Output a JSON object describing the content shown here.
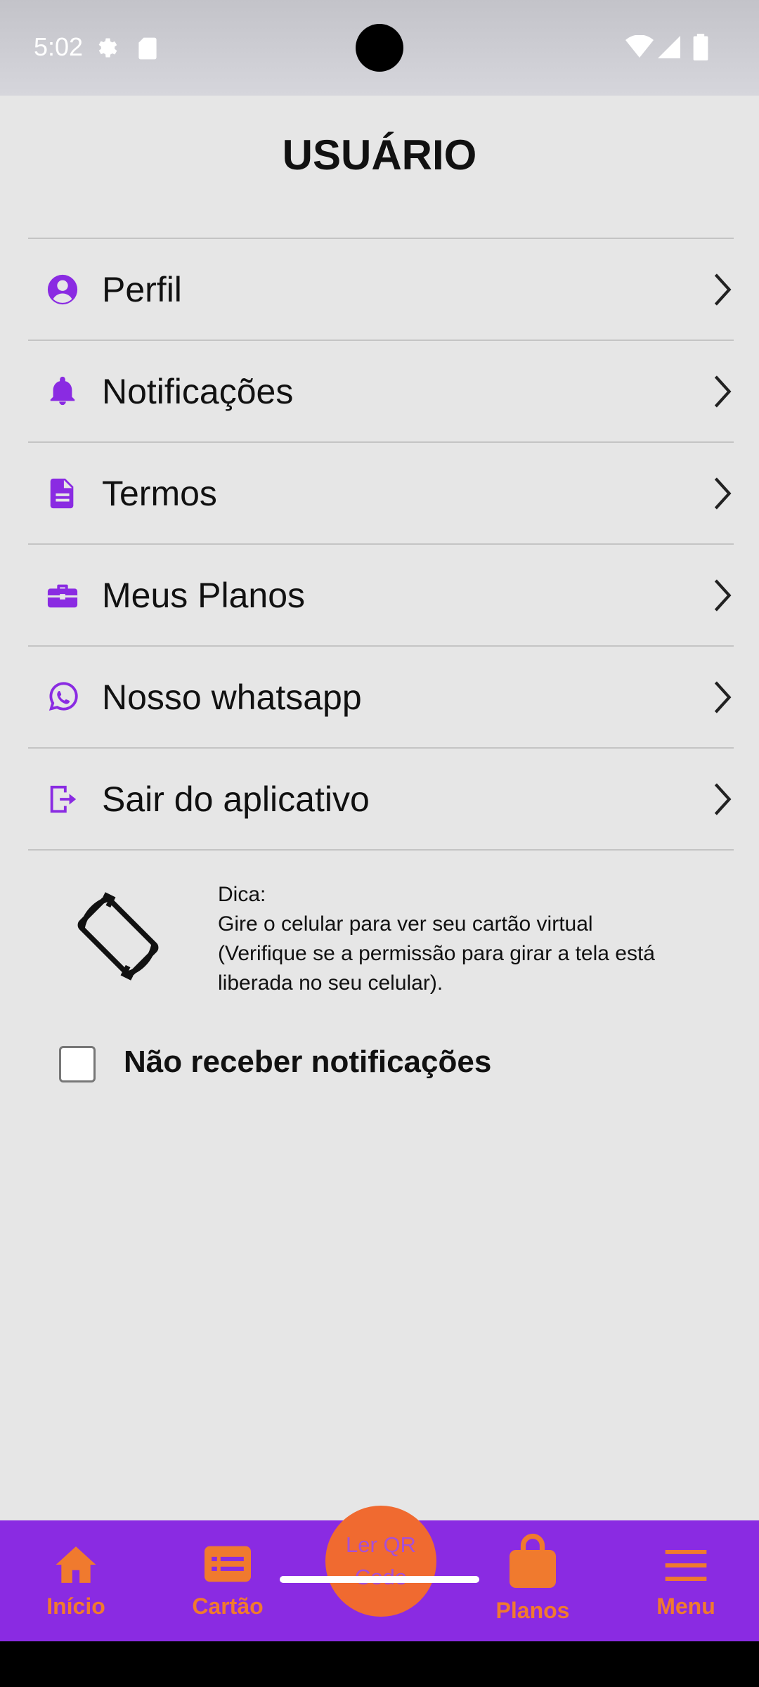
{
  "status_bar": {
    "time": "5:02",
    "icons": [
      "gear-icon",
      "sd-card-icon",
      "wifi-icon",
      "signal-icon",
      "battery-icon"
    ]
  },
  "header": {
    "title": "USUÁRIO"
  },
  "menu": {
    "accent_color": "#8a2be2",
    "items": [
      {
        "label": "Perfil",
        "icon": "account-circle-icon"
      },
      {
        "label": "Notificações",
        "icon": "bell-icon"
      },
      {
        "label": "Termos",
        "icon": "document-icon"
      },
      {
        "label": "Meus Planos",
        "icon": "briefcase-icon"
      },
      {
        "label": "Nosso whatsapp",
        "icon": "whatsapp-icon"
      },
      {
        "label": "Sair do aplicativo",
        "icon": "logout-icon"
      }
    ]
  },
  "tip": {
    "icon": "screen-rotation-icon",
    "title": "Dica:",
    "line1": "Gire o celular para ver seu cartão virtual",
    "line2": "(Verifique se a permissão para girar a tela está liberada no seu celular)."
  },
  "notifications_opt_out": {
    "label": "Não receber notificações",
    "checked": false
  },
  "bottom_nav": {
    "background": "#8a2be2",
    "accent": "#f07a2e",
    "items": [
      {
        "label": "Início",
        "icon": "home-icon"
      },
      {
        "label": "Cartão",
        "icon": "card-icon"
      },
      {
        "label": "Ler QR Code",
        "icon": "qr-button"
      },
      {
        "label": "Planos",
        "icon": "shopping-bag-icon"
      },
      {
        "label": "Menu",
        "icon": "menu-icon"
      }
    ]
  }
}
